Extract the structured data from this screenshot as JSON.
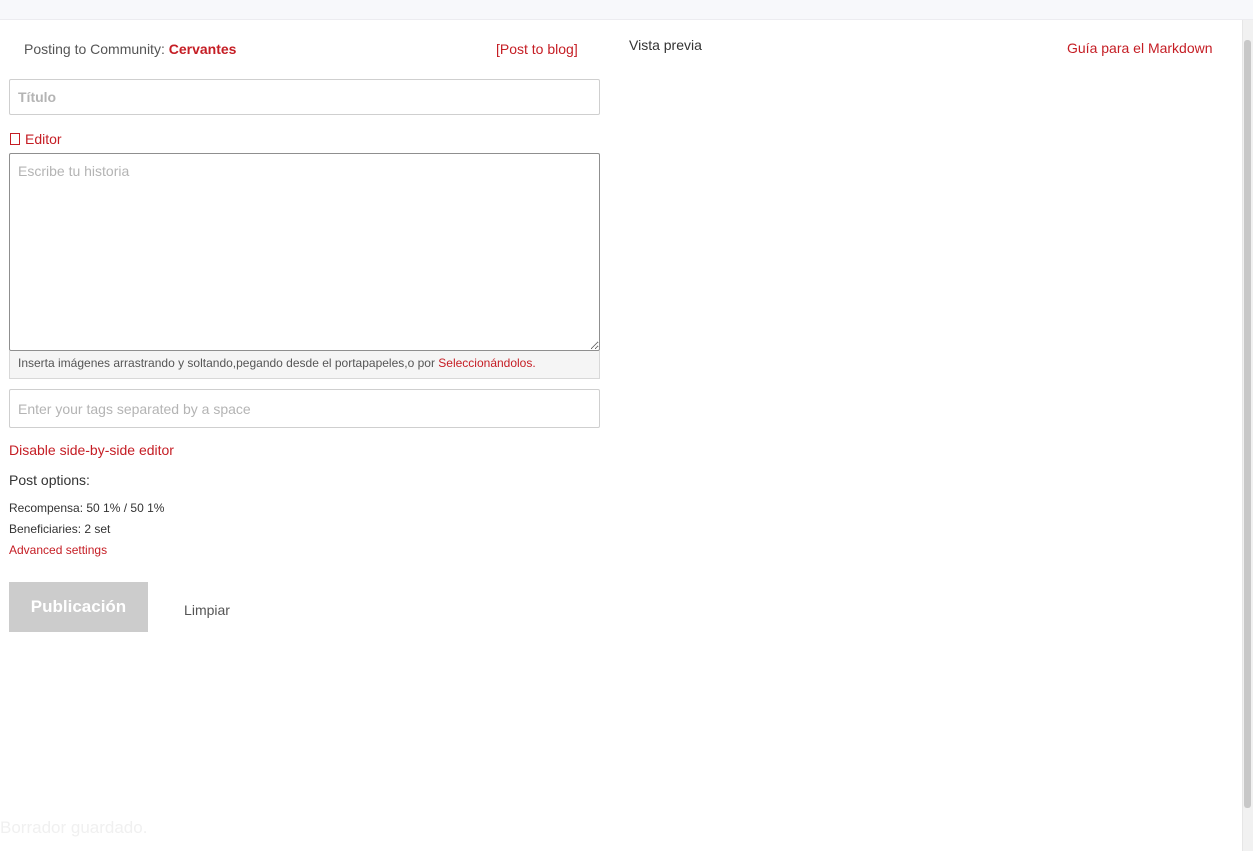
{
  "header": {
    "community_prefix": "Posting to Community:",
    "community_name": "Cervantes",
    "post_to_blog": "[Post to blog]"
  },
  "preview": {
    "title": "Vista previa",
    "markdown_guide": "Guía para el Markdown"
  },
  "form": {
    "title_placeholder": "Título",
    "editor_toggle": "Editor",
    "body_placeholder": "Escribe tu historia",
    "upload_hint_text": "Inserta imágenes arrastrando y soltando,pegando desde el portapapeles,o por ",
    "upload_hint_link": "Seleccionándolos.",
    "tags_placeholder": "Enter your tags separated by a space",
    "disable_side_by_side": "Disable side-by-side editor"
  },
  "post_options": {
    "title": "Post options:",
    "reward": "Recompensa: 50 1% / 50 1%",
    "beneficiaries": "Beneficiaries: 2 set",
    "advanced_settings": "Advanced settings"
  },
  "actions": {
    "publish": "Publicación",
    "clear": "Limpiar"
  },
  "status": {
    "draft_saved": "Borrador guardado."
  }
}
